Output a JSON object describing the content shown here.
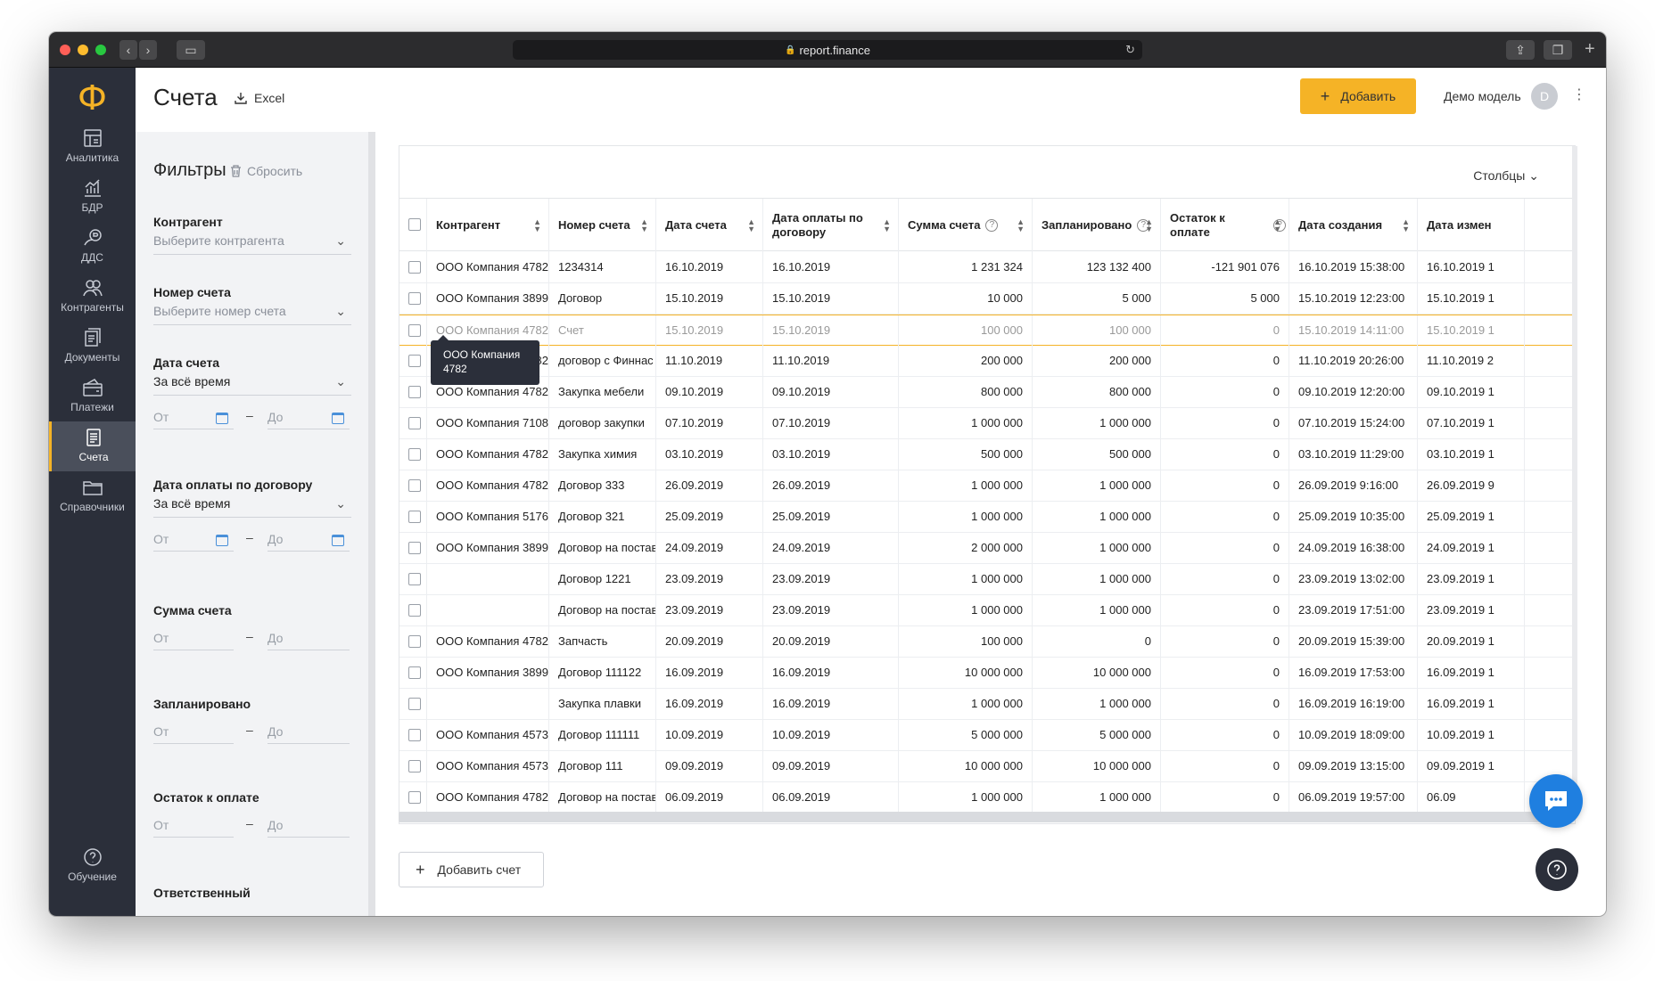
{
  "browser": {
    "url": "report.finance"
  },
  "sidebar": {
    "logo": "Ф",
    "items": [
      {
        "label": "Аналитика",
        "icon": "analytics-icon"
      },
      {
        "label": "БДР",
        "icon": "bar-chart-icon"
      },
      {
        "label": "ДДС",
        "icon": "cashflow-icon"
      },
      {
        "label": "Контрагенты",
        "icon": "contractors-icon"
      },
      {
        "label": "Документы",
        "icon": "documents-icon"
      },
      {
        "label": "Платежи",
        "icon": "payments-icon"
      },
      {
        "label": "Счета",
        "icon": "invoices-icon"
      },
      {
        "label": "Справочники",
        "icon": "folder-icon"
      }
    ],
    "active_index": 6,
    "help_label": "Обучение"
  },
  "header": {
    "title": "Счета",
    "excel_label": "Excel",
    "add_label": "Добавить",
    "user_name": "Демо модель",
    "avatar_letter": "D"
  },
  "filters": {
    "title": "Фильтры",
    "reset_label": "Сбросить",
    "contractor": {
      "label": "Контрагент",
      "placeholder": "Выберите контрагента"
    },
    "invoice_number": {
      "label": "Номер счета",
      "placeholder": "Выберите номер счета"
    },
    "invoice_date": {
      "label": "Дата счета",
      "value": "За всё время",
      "from": "От",
      "to": "До"
    },
    "payment_date": {
      "label": "Дата оплаты по договору",
      "value": "За всё время",
      "from": "От",
      "to": "До"
    },
    "amount": {
      "label": "Сумма счета",
      "from": "От",
      "to": "До"
    },
    "planned": {
      "label": "Запланировано",
      "from": "От",
      "to": "До"
    },
    "remaining": {
      "label": "Остаток к оплате",
      "from": "От",
      "to": "До"
    },
    "responsible": {
      "label": "Ответственный"
    }
  },
  "table": {
    "columns_label": "Столбцы",
    "headers": [
      "Контрагент",
      "Номер счета",
      "Дата счета",
      "Дата оплаты по договору",
      "Сумма счета",
      "Запланировано",
      "Остаток к оплате",
      "Дата создания",
      "Дата измен"
    ],
    "rows": [
      [
        "ООО Компания 4782",
        "1234314",
        "16.10.2019",
        "16.10.2019",
        "1 231 324",
        "123 132 400",
        "-121 901 076",
        "16.10.2019 15:38:00",
        "16.10.2019 1"
      ],
      [
        "ООО Компания 3899",
        "Договор",
        "15.10.2019",
        "15.10.2019",
        "10 000",
        "5 000",
        "5 000",
        "15.10.2019 12:23:00",
        "15.10.2019 1"
      ],
      [
        "ООО Компания 4782",
        "Счет",
        "15.10.2019",
        "15.10.2019",
        "100 000",
        "100 000",
        "0",
        "15.10.2019 14:11:00",
        "15.10.2019 1"
      ],
      [
        "ООО Компания 4782",
        "договор с Финнас",
        "11.10.2019",
        "11.10.2019",
        "200 000",
        "200 000",
        "0",
        "11.10.2019 20:26:00",
        "11.10.2019 2"
      ],
      [
        "ООО Компания 4782",
        "Закупка мебели",
        "09.10.2019",
        "09.10.2019",
        "800 000",
        "800 000",
        "0",
        "09.10.2019 12:20:00",
        "09.10.2019 1"
      ],
      [
        "ООО Компания 7108",
        "договор закупки",
        "07.10.2019",
        "07.10.2019",
        "1 000 000",
        "1 000 000",
        "0",
        "07.10.2019 15:24:00",
        "07.10.2019 1"
      ],
      [
        "ООО Компания 4782",
        "Закупка химия",
        "03.10.2019",
        "03.10.2019",
        "500 000",
        "500 000",
        "0",
        "03.10.2019 11:29:00",
        "03.10.2019 1"
      ],
      [
        "ООО Компания 4782",
        "Договор 333",
        "26.09.2019",
        "26.09.2019",
        "1 000 000",
        "1 000 000",
        "0",
        "26.09.2019 9:16:00",
        "26.09.2019 9"
      ],
      [
        "ООО Компания 5176",
        "Договор 321",
        "25.09.2019",
        "25.09.2019",
        "1 000 000",
        "1 000 000",
        "0",
        "25.09.2019 10:35:00",
        "25.09.2019 1"
      ],
      [
        "ООО Компания 3899",
        "Договор на постав",
        "24.09.2019",
        "24.09.2019",
        "2 000 000",
        "1 000 000",
        "0",
        "24.09.2019 16:38:00",
        "24.09.2019 1"
      ],
      [
        "",
        "Договор 1221",
        "23.09.2019",
        "23.09.2019",
        "1 000 000",
        "1 000 000",
        "0",
        "23.09.2019 13:02:00",
        "23.09.2019 1"
      ],
      [
        "",
        "Договор на постав",
        "23.09.2019",
        "23.09.2019",
        "1 000 000",
        "1 000 000",
        "0",
        "23.09.2019 17:51:00",
        "23.09.2019 1"
      ],
      [
        "ООО Компания 4782",
        "Запчасть",
        "20.09.2019",
        "20.09.2019",
        "100 000",
        "0",
        "0",
        "20.09.2019 15:39:00",
        "20.09.2019 1"
      ],
      [
        "ООО Компания 3899",
        "Договор 111122",
        "16.09.2019",
        "16.09.2019",
        "10 000 000",
        "10 000 000",
        "0",
        "16.09.2019 17:53:00",
        "16.09.2019 1"
      ],
      [
        "",
        "Закупка плавки",
        "16.09.2019",
        "16.09.2019",
        "1 000 000",
        "1 000 000",
        "0",
        "16.09.2019 16:19:00",
        "16.09.2019 1"
      ],
      [
        "ООО Компания 4573",
        "Договор 111111",
        "10.09.2019",
        "10.09.2019",
        "5 000 000",
        "5 000 000",
        "0",
        "10.09.2019 18:09:00",
        "10.09.2019 1"
      ],
      [
        "ООО Компания 4573",
        "Договор 111",
        "09.09.2019",
        "09.09.2019",
        "10 000 000",
        "10 000 000",
        "0",
        "09.09.2019 13:15:00",
        "09.09.2019 1"
      ],
      [
        "ООО Компания 4782",
        "Договор на постав",
        "06.09.2019",
        "06.09.2019",
        "1 000 000",
        "1 000 000",
        "0",
        "06.09.2019 19:57:00",
        "06.09"
      ]
    ],
    "highlighted_row": 2,
    "tooltip": "ООО Компания 4782",
    "add_invoice_label": "Добавить счет"
  },
  "colors": {
    "accent": "#f5b326",
    "sidebar": "#2b2f3a",
    "chat": "#1f7fe0"
  }
}
